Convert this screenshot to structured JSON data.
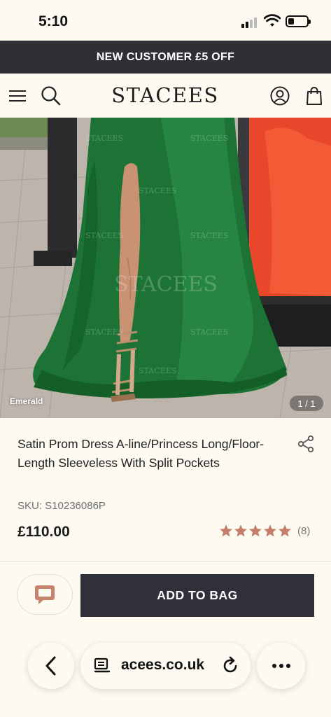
{
  "status_bar": {
    "time": "5:10"
  },
  "promo": {
    "text": "NEW CUSTOMER £5 OFF"
  },
  "header": {
    "logo": "STACEES",
    "icons": [
      "menu-icon",
      "search-icon",
      "account-icon",
      "bag-icon"
    ]
  },
  "gallery": {
    "color_label": "Emerald",
    "counter": "1 / 1",
    "watermark": "STACEES"
  },
  "product": {
    "title": "Satin Prom Dress A-line/Princess Long/Floor-Length Sleeveless With Split Pockets",
    "sku": "SKU: S10236086P",
    "price": "£110.00",
    "rating_stars": 5,
    "review_count": "(8)"
  },
  "actions": {
    "add_to_bag_label": "ADD TO BAG"
  },
  "browser": {
    "url": "acees.co.uk"
  },
  "colors": {
    "banner_bg": "#2f2f36",
    "button_bg": "#30303a",
    "star_color": "#c47e6a",
    "chat_icon_color": "#c7836e",
    "page_bg": "#fcfaf1",
    "dress_green": "#1f7a3b"
  }
}
